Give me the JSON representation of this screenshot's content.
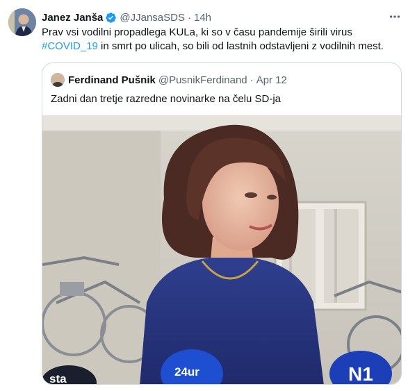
{
  "tweet": {
    "author_name": "Janez Janša",
    "author_handle": "@JJansaSDS",
    "separator": "·",
    "time": "14h",
    "verified_icon": "verified-badge-icon",
    "more_icon": "more-options-icon",
    "text_part1": "Prav vsi vodilni propadlega KULa, ki so v času pandemije širili virus ",
    "hashtag": "#COVID_19",
    "text_part2": " in smrt po ulicah, so bili od lastnih odstavljeni z vodilnih mest."
  },
  "quoted": {
    "author_name": "Ferdinand Pušnik",
    "author_handle": "@PusnikFerdinand",
    "separator": "·",
    "date": "Apr 12",
    "text": "Zadni dan tretje razredne novinarke na čelu SD-ja"
  },
  "media": {
    "description_icon": "photo-image",
    "mic_label_left": "sta",
    "mic_label_center": "24ur",
    "mic_label_right": "N1"
  },
  "colors": {
    "accent": "#1d9bf0",
    "secondary_text": "#536471",
    "border": "#cfd9de"
  }
}
